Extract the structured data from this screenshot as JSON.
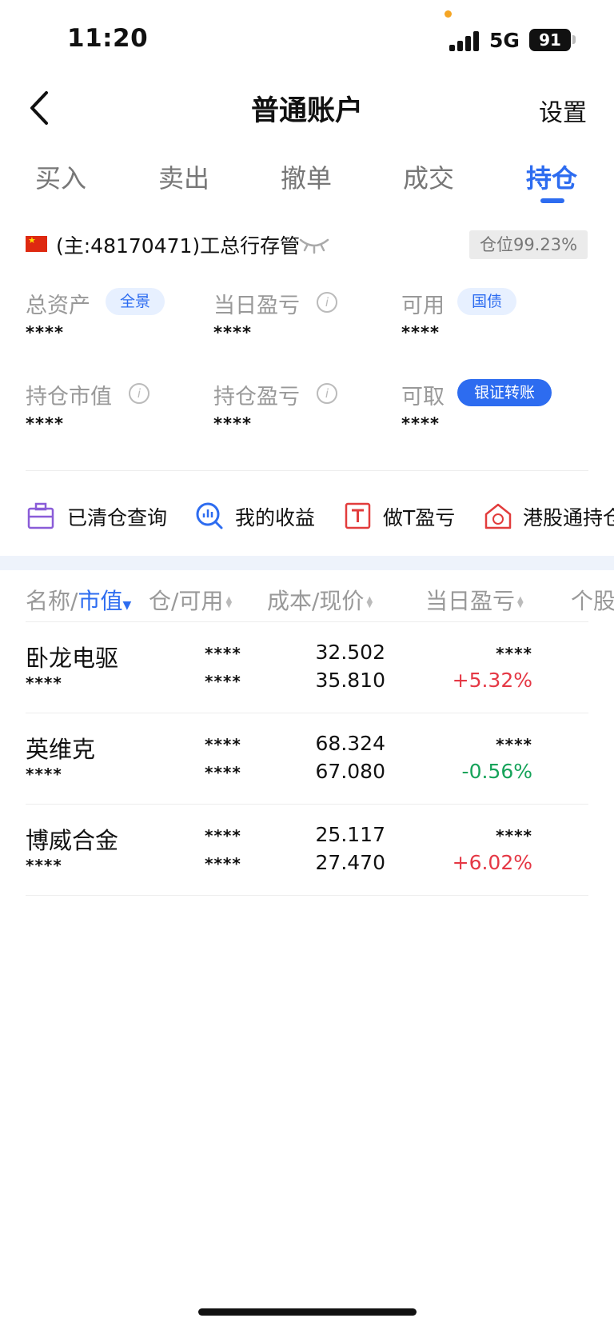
{
  "status_bar": {
    "time": "11:20",
    "network": "5G",
    "battery": "91"
  },
  "nav": {
    "title": "普通账户",
    "settings": "设置"
  },
  "tabs": [
    {
      "label": "买入"
    },
    {
      "label": "卖出"
    },
    {
      "label": "撤单"
    },
    {
      "label": "成交"
    },
    {
      "label": "持仓",
      "active": true
    }
  ],
  "account": {
    "text": "(主:48170471)工总行存管",
    "position_ratio": "仓位99.23%"
  },
  "metrics": {
    "total_assets": {
      "label": "总资产",
      "badge": "全景",
      "value": "****"
    },
    "daily_pnl": {
      "label": "当日盈亏",
      "value": "****"
    },
    "available": {
      "label": "可用",
      "badge": "国债",
      "value": "****"
    },
    "market_value": {
      "label": "持仓市值",
      "value": "****"
    },
    "position_pnl": {
      "label": "持仓盈亏",
      "value": "****"
    },
    "withdrawable": {
      "label": "可取",
      "badge": "银证转账",
      "value": "****"
    }
  },
  "info_glyph": "i",
  "shortcuts": [
    {
      "label": "已清仓查询",
      "icon": "briefcase-icon"
    },
    {
      "label": "我的收益",
      "icon": "chart-search-icon"
    },
    {
      "label": "做T盈亏",
      "icon": "t-box-icon"
    },
    {
      "label": "港股通持仓",
      "icon": "hk-house-icon"
    }
  ],
  "table": {
    "headers": {
      "name": "名称/",
      "market_value": "市值",
      "position": "仓/可用",
      "cost": "成本/现价",
      "daily": "当日盈亏",
      "stock": "个股"
    },
    "rows": [
      {
        "name": "卧龙电驱",
        "sub": "****",
        "pos": "****",
        "avail": "****",
        "cost": "32.502",
        "price": "35.810",
        "daily": "****",
        "pct": "+5.32%",
        "dir": "up"
      },
      {
        "name": "英维克",
        "sub": "****",
        "pos": "****",
        "avail": "****",
        "cost": "68.324",
        "price": "67.080",
        "daily": "****",
        "pct": "-0.56%",
        "dir": "down"
      },
      {
        "name": "博威合金",
        "sub": "****",
        "pos": "****",
        "avail": "****",
        "cost": "25.117",
        "price": "27.470",
        "daily": "****",
        "pct": "+6.02%",
        "dir": "up"
      }
    ]
  },
  "colors": {
    "accent": "#2d6cf0",
    "up": "#e53845",
    "down": "#16a35a"
  }
}
